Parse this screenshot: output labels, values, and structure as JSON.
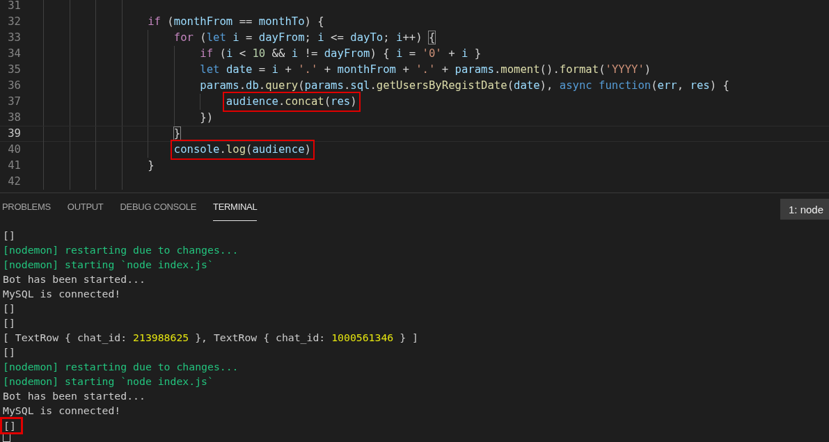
{
  "editor": {
    "lines": [
      {
        "number": "31",
        "current": false
      },
      {
        "number": "32",
        "current": false,
        "highlighted": false,
        "tokens": [
          {
            "kind": "control",
            "text": "                if"
          },
          {
            "kind": "op",
            "text": " ("
          },
          {
            "kind": "var",
            "text": "monthFrom"
          },
          {
            "kind": "op",
            "text": " == "
          },
          {
            "kind": "var",
            "text": "monthTo"
          },
          {
            "kind": "op",
            "text": ") {"
          }
        ]
      },
      {
        "number": "33",
        "current": false,
        "highlighted": false,
        "tokens": [
          {
            "kind": "control",
            "text": "                    for"
          },
          {
            "kind": "op",
            "text": " ("
          },
          {
            "kind": "storage",
            "text": "let "
          },
          {
            "kind": "var",
            "text": "i"
          },
          {
            "kind": "op",
            "text": " = "
          },
          {
            "kind": "var",
            "text": "dayFrom"
          },
          {
            "kind": "op",
            "text": "; "
          },
          {
            "kind": "var",
            "text": "i"
          },
          {
            "kind": "op",
            "text": " <= "
          },
          {
            "kind": "var",
            "text": "dayTo"
          },
          {
            "kind": "op",
            "text": "; "
          },
          {
            "kind": "var",
            "text": "i"
          },
          {
            "kind": "op",
            "text": "++) "
          },
          {
            "kind": "bracket",
            "text": "{"
          }
        ]
      },
      {
        "number": "34",
        "current": false,
        "highlighted": false,
        "tokens": [
          {
            "kind": "control",
            "text": "                        if"
          },
          {
            "kind": "op",
            "text": " ("
          },
          {
            "kind": "var",
            "text": "i"
          },
          {
            "kind": "op",
            "text": " < "
          },
          {
            "kind": "num",
            "text": "10"
          },
          {
            "kind": "op",
            "text": " && "
          },
          {
            "kind": "var",
            "text": "i"
          },
          {
            "kind": "op",
            "text": " != "
          },
          {
            "kind": "var",
            "text": "dayFrom"
          },
          {
            "kind": "op",
            "text": ") { "
          },
          {
            "kind": "var",
            "text": "i"
          },
          {
            "kind": "op",
            "text": " = "
          },
          {
            "kind": "str",
            "text": "'0'"
          },
          {
            "kind": "op",
            "text": " + "
          },
          {
            "kind": "var",
            "text": "i"
          },
          {
            "kind": "op",
            "text": " }"
          }
        ]
      },
      {
        "number": "35",
        "current": false,
        "highlighted": false,
        "tokens": [
          {
            "kind": "storage",
            "text": "                        let "
          },
          {
            "kind": "var",
            "text": "date"
          },
          {
            "kind": "op",
            "text": " = "
          },
          {
            "kind": "var",
            "text": "i"
          },
          {
            "kind": "op",
            "text": " + "
          },
          {
            "kind": "str",
            "text": "'.'"
          },
          {
            "kind": "op",
            "text": " + "
          },
          {
            "kind": "var",
            "text": "monthFrom"
          },
          {
            "kind": "op",
            "text": " + "
          },
          {
            "kind": "str",
            "text": "'.'"
          },
          {
            "kind": "op",
            "text": " + "
          },
          {
            "kind": "var",
            "text": "params"
          },
          {
            "kind": "op",
            "text": "."
          },
          {
            "kind": "fn",
            "text": "moment"
          },
          {
            "kind": "op",
            "text": "()."
          },
          {
            "kind": "fn",
            "text": "format"
          },
          {
            "kind": "op",
            "text": "("
          },
          {
            "kind": "str",
            "text": "'YYYY'"
          },
          {
            "kind": "op",
            "text": ")"
          }
        ]
      },
      {
        "number": "36",
        "current": false,
        "highlighted": false,
        "tokens": [
          {
            "kind": "var",
            "text": "                        params"
          },
          {
            "kind": "op",
            "text": "."
          },
          {
            "kind": "var",
            "text": "db"
          },
          {
            "kind": "op",
            "text": "."
          },
          {
            "kind": "fn",
            "text": "query"
          },
          {
            "kind": "op",
            "text": "("
          },
          {
            "kind": "var",
            "text": "params"
          },
          {
            "kind": "op",
            "text": "."
          },
          {
            "kind": "var",
            "text": "sql"
          },
          {
            "kind": "op",
            "text": "."
          },
          {
            "kind": "fn",
            "text": "getUsersByRegistDate"
          },
          {
            "kind": "op",
            "text": "("
          },
          {
            "kind": "var",
            "text": "date"
          },
          {
            "kind": "op",
            "text": "), "
          },
          {
            "kind": "storage",
            "text": "async "
          },
          {
            "kind": "storage",
            "text": "function"
          },
          {
            "kind": "op",
            "text": "("
          },
          {
            "kind": "var",
            "text": "err"
          },
          {
            "kind": "op",
            "text": ", "
          },
          {
            "kind": "var",
            "text": "res"
          },
          {
            "kind": "op",
            "text": ") {"
          }
        ]
      },
      {
        "number": "37",
        "current": false,
        "highlighted": true,
        "tokens": [
          {
            "kind": "var",
            "text": "                            audience"
          },
          {
            "kind": "op",
            "text": "."
          },
          {
            "kind": "fn",
            "text": "concat"
          },
          {
            "kind": "op",
            "text": "("
          },
          {
            "kind": "var",
            "text": "res"
          },
          {
            "kind": "op",
            "text": ")"
          }
        ]
      },
      {
        "number": "38",
        "current": false,
        "highlighted": false,
        "tokens": [
          {
            "kind": "op",
            "text": "                        })"
          }
        ]
      },
      {
        "number": "39",
        "current": true,
        "highlighted": false,
        "tokens": [
          {
            "kind": "bracket",
            "text": "                    }"
          }
        ]
      },
      {
        "number": "40",
        "current": false,
        "highlighted": true,
        "tokens": [
          {
            "kind": "var",
            "text": "                    console"
          },
          {
            "kind": "op",
            "text": "."
          },
          {
            "kind": "fn",
            "text": "log"
          },
          {
            "kind": "op",
            "text": "("
          },
          {
            "kind": "var",
            "text": "audience"
          },
          {
            "kind": "op",
            "text": ")"
          }
        ]
      },
      {
        "number": "41",
        "current": false,
        "highlighted": false,
        "tokens": [
          {
            "kind": "op",
            "text": "                }"
          }
        ]
      },
      {
        "number": "42",
        "current": false
      }
    ]
  },
  "panel": {
    "tabs": [
      {
        "label": "PROBLEMS",
        "selected": false
      },
      {
        "label": "OUTPUT",
        "selected": false
      },
      {
        "label": "DEBUG CONSOLE",
        "selected": false
      },
      {
        "label": "TERMINAL",
        "selected": true
      }
    ],
    "terminal_select": "1: node",
    "terminal": [
      {
        "highlighted": false,
        "segments": [
          {
            "kind": "text",
            "text": "[]"
          }
        ]
      },
      {
        "highlighted": false,
        "segments": [
          {
            "kind": "nodemon",
            "text": "[nodemon] restarting due to changes..."
          }
        ]
      },
      {
        "highlighted": false,
        "segments": [
          {
            "kind": "nodemon",
            "text": "[nodemon] starting `node index.js`"
          }
        ]
      },
      {
        "highlighted": false,
        "segments": [
          {
            "kind": "text",
            "text": "Bot has been started..."
          }
        ]
      },
      {
        "highlighted": false,
        "segments": [
          {
            "kind": "text",
            "text": "MySQL is connected!"
          }
        ]
      },
      {
        "highlighted": false,
        "segments": [
          {
            "kind": "text",
            "text": "[]"
          }
        ]
      },
      {
        "highlighted": false,
        "segments": [
          {
            "kind": "text",
            "text": "[]"
          }
        ]
      },
      {
        "highlighted": false,
        "segments": [
          {
            "kind": "text",
            "text": "[ TextRow { chat_id: "
          },
          {
            "kind": "number",
            "text": "213988625"
          },
          {
            "kind": "text",
            "text": " }, TextRow { chat_id: "
          },
          {
            "kind": "number",
            "text": "1000561346"
          },
          {
            "kind": "text",
            "text": " } ]"
          }
        ]
      },
      {
        "highlighted": false,
        "segments": [
          {
            "kind": "text",
            "text": "[]"
          }
        ]
      },
      {
        "highlighted": false,
        "segments": [
          {
            "kind": "nodemon",
            "text": "[nodemon] restarting due to changes..."
          }
        ]
      },
      {
        "highlighted": false,
        "segments": [
          {
            "kind": "nodemon",
            "text": "[nodemon] starting `node index.js`"
          }
        ]
      },
      {
        "highlighted": false,
        "segments": [
          {
            "kind": "text",
            "text": "Bot has been started..."
          }
        ]
      },
      {
        "highlighted": false,
        "segments": [
          {
            "kind": "text",
            "text": "MySQL is connected!"
          }
        ]
      },
      {
        "highlighted": true,
        "segments": [
          {
            "kind": "text",
            "text": "[]"
          }
        ]
      }
    ]
  }
}
